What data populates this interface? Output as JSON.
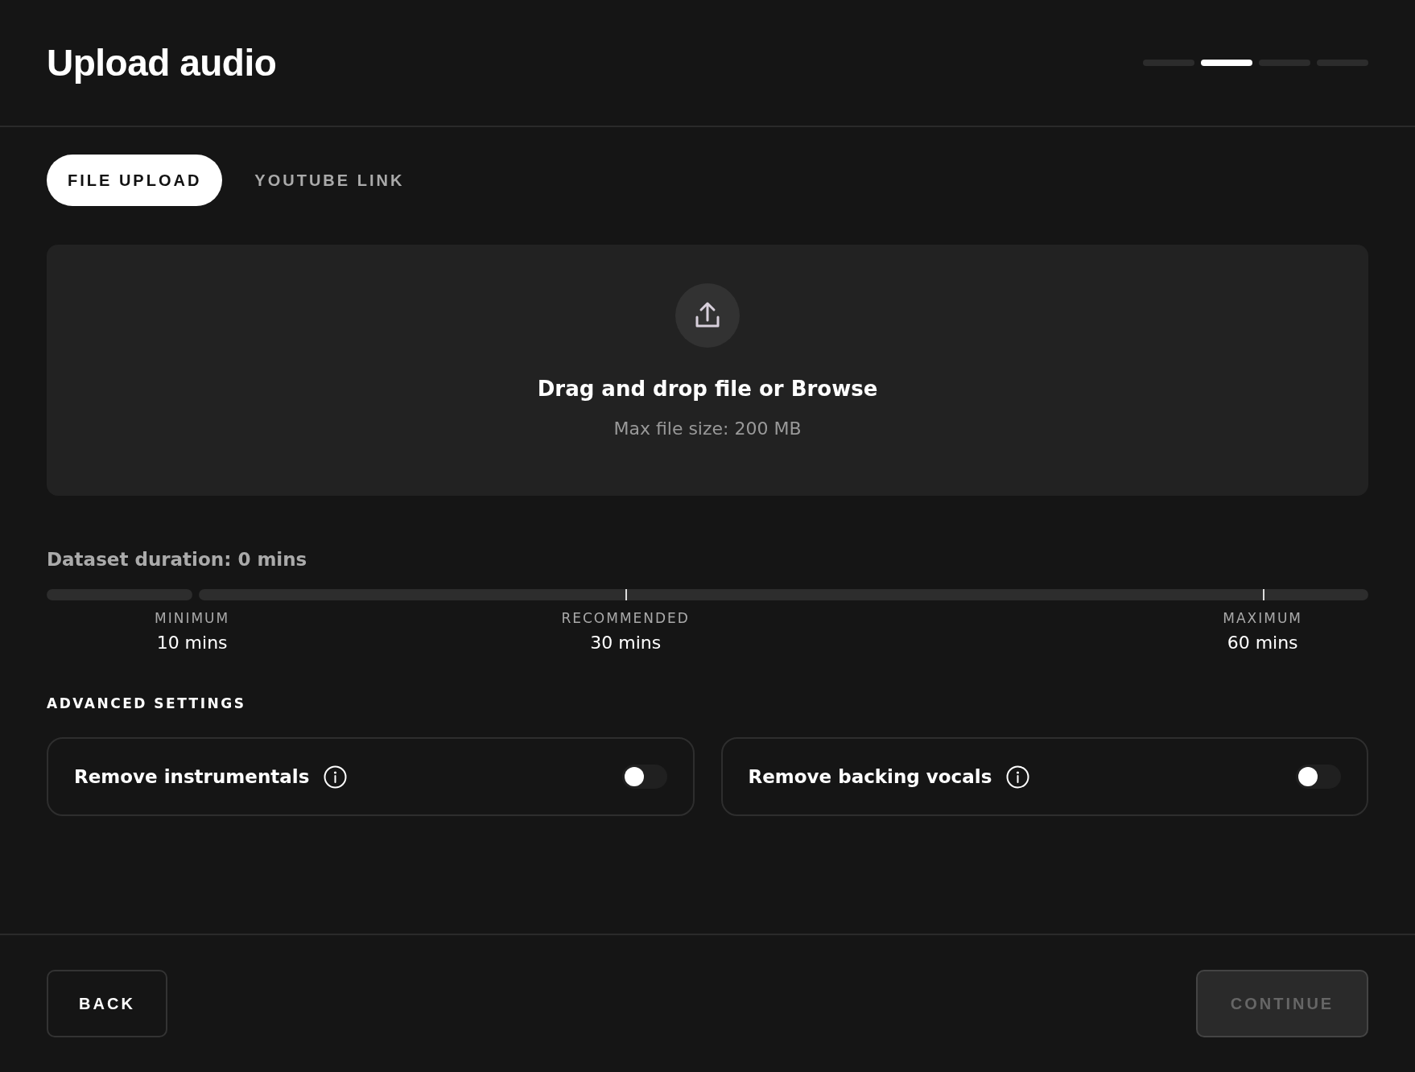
{
  "header": {
    "title": "Upload audio",
    "steps": [
      {
        "selected": false
      },
      {
        "selected": true
      },
      {
        "selected": false
      },
      {
        "selected": false
      }
    ]
  },
  "tabs": [
    {
      "label": "FILE UPLOAD",
      "selected": true
    },
    {
      "label": "YOUTUBE LINK",
      "selected": false
    }
  ],
  "dropzone": {
    "title": "Drag and drop file or Browse",
    "hint": "Max file size: 200 MB"
  },
  "duration": {
    "label": "Dataset duration: 0 mins",
    "markers": [
      {
        "caption": "MINIMUM",
        "value": "10 mins"
      },
      {
        "caption": "RECOMMENDED",
        "value": "30 mins"
      },
      {
        "caption": "MAXIMUM",
        "value": "60 mins"
      }
    ]
  },
  "advanced": {
    "heading": "ADVANCED SETTINGS",
    "options": [
      {
        "label": "Remove instrumentals",
        "on": false
      },
      {
        "label": "Remove backing vocals",
        "on": false
      }
    ]
  },
  "footer": {
    "back": "BACK",
    "continue": {
      "label": "CONTINUE",
      "disabled": true
    }
  }
}
